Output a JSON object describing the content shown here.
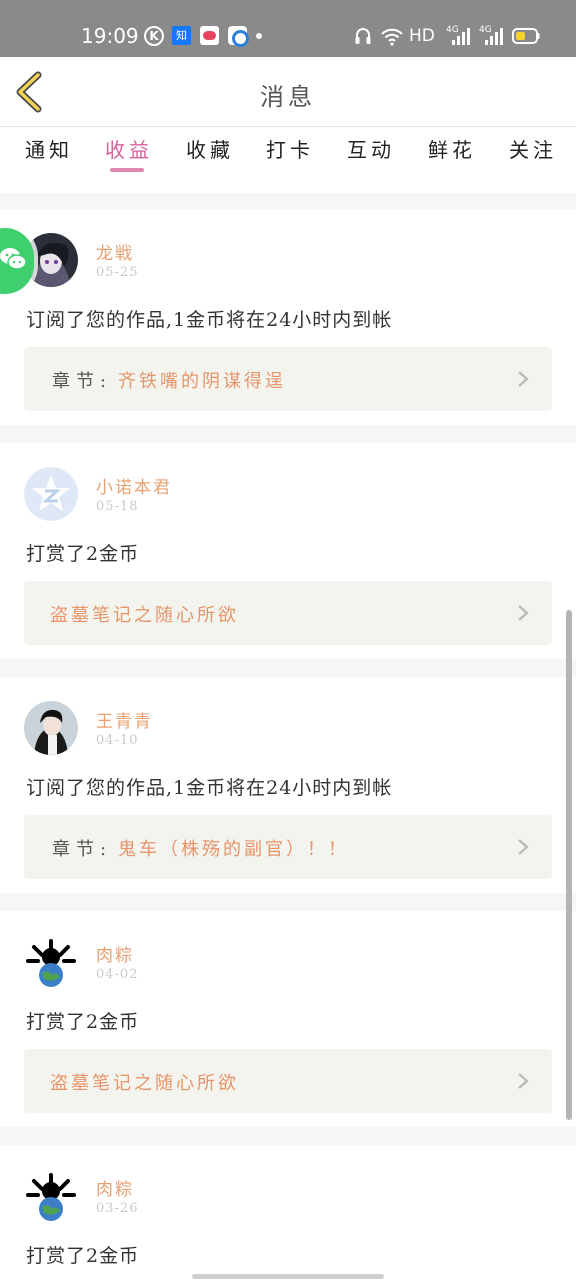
{
  "status_bar": {
    "time": "19:09",
    "zhi_label": "知",
    "network": "HD",
    "signal1": "4G",
    "signal2": "4G",
    "icons": [
      "k-circle-icon",
      "zhihu-icon",
      "app-icon",
      "browser-icon",
      "headphones-icon",
      "wifi-icon",
      "signal-icon",
      "battery-icon"
    ]
  },
  "header": {
    "title": "消息"
  },
  "tabs": [
    {
      "label": "通知",
      "active": false
    },
    {
      "label": "收益",
      "active": true
    },
    {
      "label": "收藏",
      "active": false
    },
    {
      "label": "打卡",
      "active": false
    },
    {
      "label": "互动",
      "active": false
    },
    {
      "label": "鲜花",
      "active": false
    },
    {
      "label": "关注",
      "active": false
    }
  ],
  "cards": [
    {
      "name": "龙戦",
      "date": "05-25",
      "message": "订阅了您的作品,1金币将在24小时内到帐",
      "chapter_label": "章节:",
      "chapter_title": "齐铁嘴的阴谋得逞"
    },
    {
      "name": "小诺本君",
      "date": "05-18",
      "message": "打赏了2金币",
      "chapter_label": "",
      "chapter_title": "盗墓笔记之随心所欲"
    },
    {
      "name": "王青青",
      "date": "04-10",
      "message": "订阅了您的作品,1金币将在24小时内到帐",
      "chapter_label": "章节:",
      "chapter_title": "鬼车（株殇的副官）！！"
    },
    {
      "name": "肉粽",
      "date": "04-02",
      "message": "打赏了2金币",
      "chapter_label": "",
      "chapter_title": "盗墓笔记之随心所欲"
    },
    {
      "name": "肉粽",
      "date": "03-26",
      "message": "打赏了2金币",
      "chapter_label": "",
      "chapter_title": ""
    }
  ],
  "colors": {
    "accent": "#d5609c",
    "name": "#e8a070",
    "chapter": "#e6956a",
    "status_bar": "#8a8a8a"
  }
}
